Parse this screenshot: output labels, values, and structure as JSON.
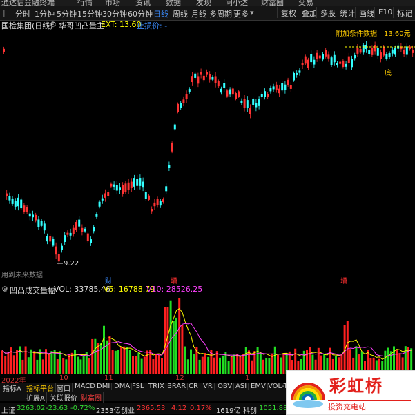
{
  "menu": [
    "通达信金融终端",
    "行情",
    "市场",
    "资讯",
    "数据",
    "发现",
    "问小达",
    "财富圈",
    "交易"
  ],
  "periods": [
    {
      "label": "分时",
      "active": false
    },
    {
      "label": "1分钟",
      "active": false
    },
    {
      "label": "5分钟",
      "active": false
    },
    {
      "label": "15分钟",
      "active": false
    },
    {
      "label": "30分钟",
      "active": false
    },
    {
      "label": "60分钟",
      "active": false
    },
    {
      "label": "日线",
      "active": true
    },
    {
      "label": "周线",
      "active": false
    },
    {
      "label": "月线",
      "active": false
    },
    {
      "label": "多周期",
      "active": false
    },
    {
      "label": "更多",
      "active": false
    }
  ],
  "right_buttons": [
    "复权",
    "叠加",
    "多股",
    "统计",
    "画线",
    "F10",
    "标记"
  ],
  "header": {
    "stock": "国检集团(日线)",
    "indicator": "华哥凹凸量主",
    "ext": "EXT: 13.60",
    "stop": "止损价: -"
  },
  "price_chart": {
    "annotations": {
      "high_label": "附加条件数据",
      "high_value": "13.60元",
      "bottom_label": "底",
      "low_value": "9.22",
      "future_label": "用到未来数据"
    },
    "markers": [
      {
        "label": "财",
        "color": "#3b8cff"
      },
      {
        "label": "增",
        "color": "#ff3030"
      },
      {
        "label": "增",
        "color": "#ff3030"
      }
    ]
  },
  "volume": {
    "title": "凹凸成交量幅",
    "vol": "VOL: 33785.46",
    "v5": "V5: 16788.79",
    "v10": "V10: 28526.25"
  },
  "dates": [
    "2022年",
    "10",
    "11",
    "12",
    "1"
  ],
  "indicator_tabs": [
    "指标A",
    "指标平台",
    "窗口",
    "MACD",
    "DMI",
    "DMA",
    "FSL",
    "TRIX",
    "BRAR",
    "CR",
    "VR",
    "OBV",
    "ASI",
    "EMV",
    "VOL-TDX"
  ],
  "sub_tabs": [
    "扩展A",
    "关联报价",
    "财富圈"
  ],
  "status": {
    "sh_label": "上证",
    "sh_value": "3263.02",
    "sh_change": "-23.63",
    "sh_pct": "-0.72%",
    "sh_amount": "2353亿",
    "cy_label": "创业",
    "cy_value": "2365.53",
    "cy_change": "4.12",
    "cy_pct": "0.17%",
    "cy_amount": "1619亿",
    "kc_label": "科创",
    "kc_value": "1051.88"
  },
  "watermark": {
    "title": "彩虹桥",
    "subtitle": "投资充电站"
  },
  "colors": {
    "up": "#ff3333",
    "down": "#33ffff",
    "vol_up": "#ff2020",
    "vol_down": "#22dd22",
    "v5": "#ffff00",
    "v10": "#ff40ff",
    "ext_line": "#ffff00",
    "active": "#3b8cff"
  }
}
